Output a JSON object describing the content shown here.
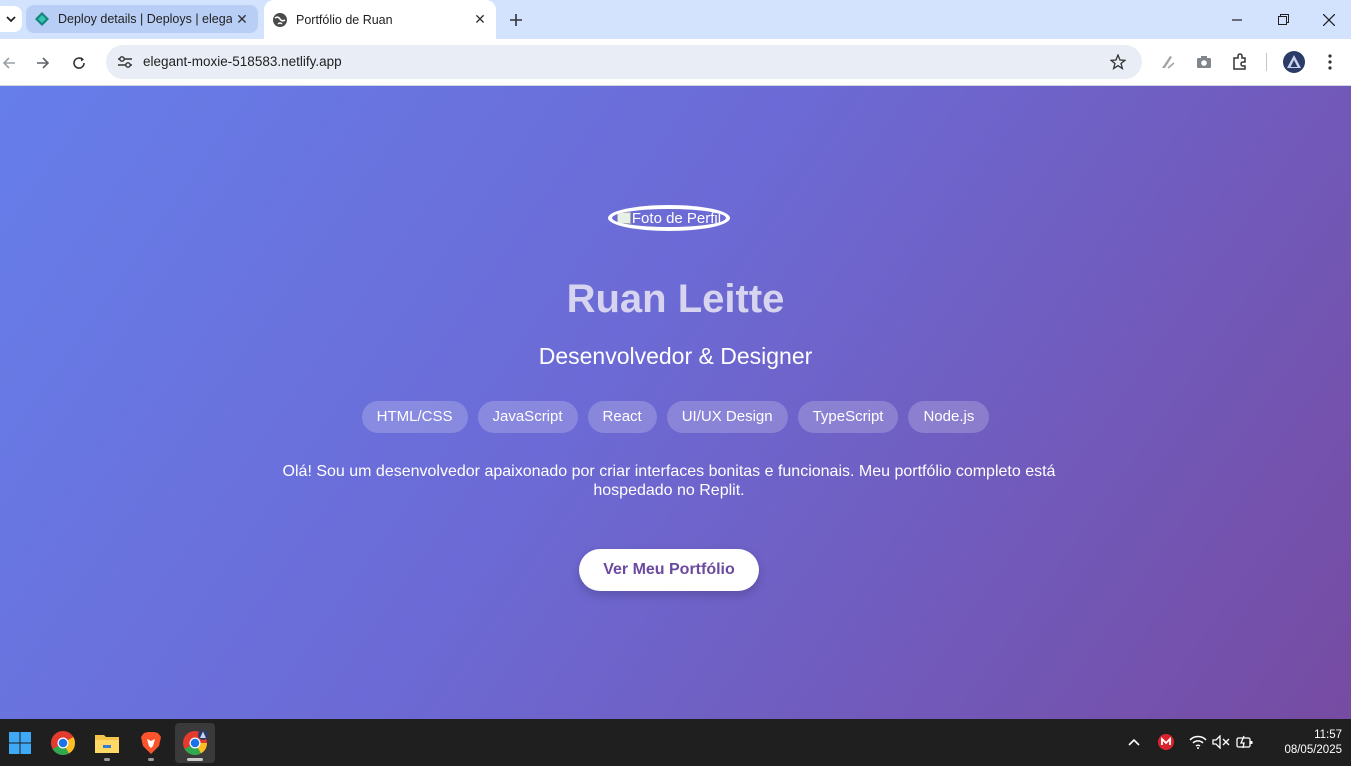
{
  "browser": {
    "tabs": [
      {
        "title": "Deploy details | Deploys | elega",
        "favicon": "netlify-icon",
        "active": false
      },
      {
        "title": "Portfólio de Ruan",
        "favicon": "globe-icon",
        "active": true
      }
    ],
    "url": "elegant-moxie-518583.netlify.app"
  },
  "page": {
    "profile_alt": "Foto de Perfil",
    "name": "Ruan Leitte",
    "subtitle": "Desenvolvedor & Designer",
    "skills": [
      "HTML/CSS",
      "JavaScript",
      "React",
      "UI/UX Design",
      "TypeScript",
      "Node.js"
    ],
    "bio": "Olá! Sou um desenvolvedor apaixonado por criar interfaces bonitas e funcionais. Meu portfólio completo está hospedado no Replit.",
    "cta_label": "Ver Meu Portfólio"
  },
  "taskbar": {
    "time": "11:57",
    "date": "08/05/2025"
  },
  "colors": {
    "gradient_start": "#667eea",
    "gradient_end": "#764ba2",
    "cta_text": "#6b4a9f"
  }
}
